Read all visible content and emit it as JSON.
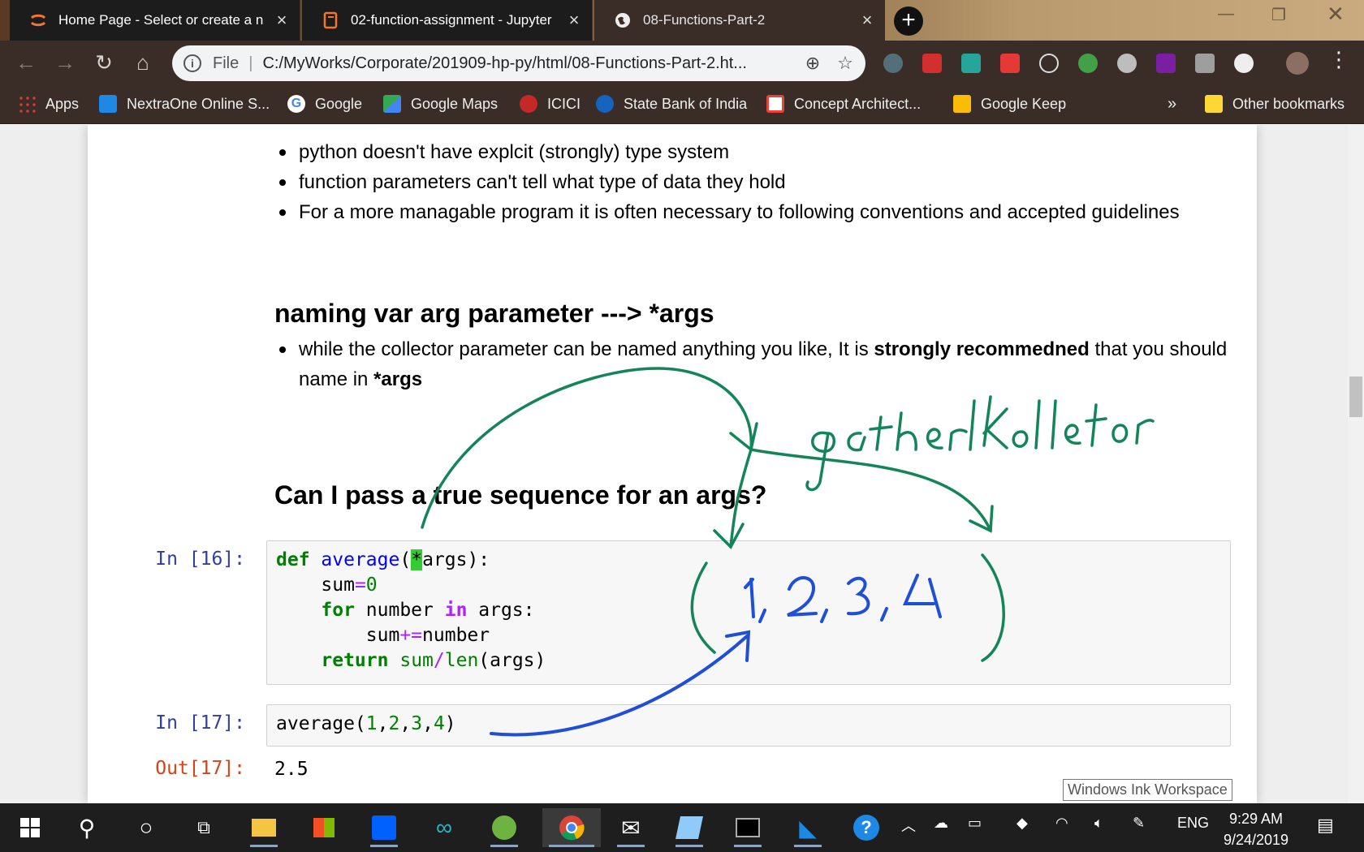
{
  "browser": {
    "tabs": [
      {
        "title": "Home Page - Select or create a n",
        "icon": "jupyter-icon",
        "active": false
      },
      {
        "title": "02-function-assignment - Jupyter",
        "icon": "notebook-icon",
        "active": false
      },
      {
        "title": "08-Functions-Part-2",
        "icon": "globe-icon",
        "active": true
      }
    ],
    "address": {
      "scheme": "File",
      "url": "C:/MyWorks/Corporate/201909-hp-py/html/08-Functions-Part-2.ht..."
    },
    "bookmarks": [
      {
        "label": "Apps",
        "icon": "apps-grid-icon",
        "color": "#e53935"
      },
      {
        "label": "NextraOne Online S...",
        "icon": "nextraone-icon",
        "color": "#1e88e5"
      },
      {
        "label": "Google",
        "icon": "google-icon",
        "color": "#ffffff"
      },
      {
        "label": "Google Maps",
        "icon": "maps-icon",
        "color": "#34a853"
      },
      {
        "label": "ICICI",
        "icon": "icici-icon",
        "color": "#c62828"
      },
      {
        "label": "State Bank of India",
        "icon": "sbi-icon",
        "color": "#1565c0"
      },
      {
        "label": "Concept Architect...",
        "icon": "gmail-icon",
        "color": "#ea4335"
      },
      {
        "label": "Google Keep",
        "icon": "keep-icon",
        "color": "#fbbc04"
      }
    ],
    "bookmarks_overflow": "»",
    "other_bookmarks": "Other bookmarks"
  },
  "notebook": {
    "bullets_1": [
      "python doesn't have explcit (strongly) type system",
      "function parameters can't tell what type of data they hold",
      "For a more managable program it is often necessary to following conventions and accepted guidelines"
    ],
    "heading_1": "naming var arg parameter ---> *args",
    "bullet_2_before": "while the collector parameter can be named anything you like, It is ",
    "bullet_2_bold": "strongly recommedned",
    "bullet_2_after": " that you should name in ",
    "bullet_2_bold2": "*args",
    "heading_2": "Can I pass a true sequence for an args?",
    "cell_16": {
      "prompt": "In [16]:",
      "lines": [
        "def average(*args):",
        "    sum=0",
        "    for number in args:",
        "        sum+=number",
        "    return sum/len(args)"
      ]
    },
    "cell_17": {
      "prompt": "In [17]:",
      "code": "average(1,2,3,4)",
      "out_prompt": "Out[17]:",
      "output": "2.5"
    }
  },
  "annotations": {
    "handwritten_1": "gather/collector",
    "handwritten_2": "( 1, 2, 3, 4 )"
  },
  "ink_workspace": "Windows Ink Workspace",
  "taskbar": {
    "language": "ENG",
    "time": "9:29 AM",
    "date": "9/24/2019"
  }
}
